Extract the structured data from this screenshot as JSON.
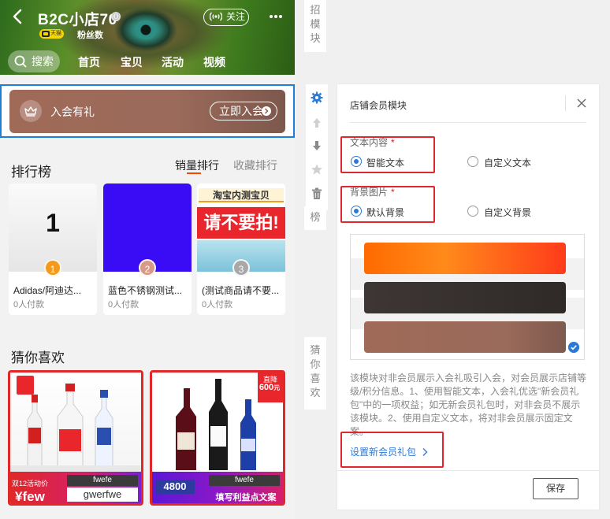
{
  "store": {
    "name": "B2C小店70",
    "info_glyph": "ⓘ",
    "badge_text": "天猫",
    "fans_label": "粉丝数",
    "follow_label": "关注",
    "search_label": "搜索",
    "nav": [
      "首页",
      "宝贝",
      "活动",
      "视频"
    ]
  },
  "member_banner": {
    "text": "入会有礼",
    "button": "立即入会"
  },
  "ranking": {
    "title": "排行榜",
    "tabs": [
      "销量排行",
      "收藏排行"
    ],
    "items": [
      {
        "rank": "1",
        "name": "Adidas/阿迪达...",
        "sales": "0人付款",
        "image_text": "1",
        "medal_color": "#f39a1d"
      },
      {
        "rank": "2",
        "name": "蓝色不锈钢测试...",
        "sales": "0人付款",
        "image_text": "",
        "medal_color": "#d89a86"
      },
      {
        "rank": "3",
        "name": "(测试商品请不要...",
        "sales": "0人付款",
        "image_text": "",
        "medal_color": "#a8a8a8"
      }
    ],
    "item3_banner_top": "淘宝内测宝贝",
    "item3_banner_main": "请不要拍!"
  },
  "guess": {
    "title": "猜你喜欢",
    "cards": [
      {
        "top_tag": "fwefe",
        "sub_tag": "gwerfwe",
        "price": "few",
        "promo": "双12活动价"
      },
      {
        "top_tag": "fwefe",
        "price": "4800",
        "promo": "填写利益点文案",
        "badge_top": "直降",
        "badge_num": "600",
        "badge_unit": "元"
      }
    ]
  },
  "side_labels": {
    "top": "招模块",
    "mid": "榜",
    "bottom": "猜你喜欢"
  },
  "panel": {
    "title": "店铺会员模块",
    "text_content_label": "文本内容",
    "text_options": [
      "智能文本",
      "自定义文本"
    ],
    "bg_label": "背景图片",
    "bg_options": [
      "默认背景",
      "自定义背景"
    ],
    "swatches": [
      "#ff6a00",
      "#3d3634",
      "#a06a58"
    ],
    "help": "该模块对非会员展示入会礼吸引入会，对会员展示店铺等级/积分信息。1、使用智能文本，入会礼优选\"新会员礼包\"中的一项权益；如无新会员礼包时，对非会员不展示该模块。2、使用自定义文本，将对非会员展示固定文案。",
    "link": "设置新会员礼包",
    "save": "保存",
    "required_mark": "*"
  }
}
